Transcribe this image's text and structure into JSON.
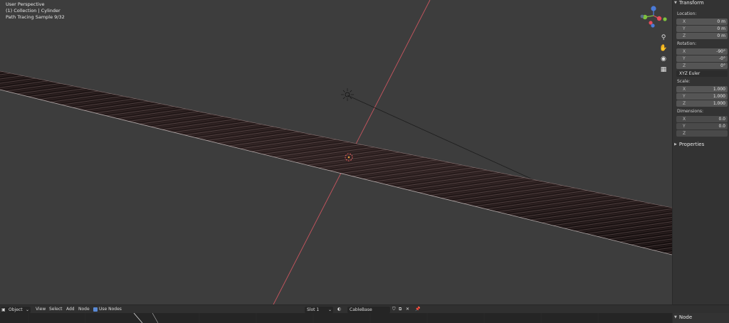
{
  "viewport": {
    "perspective": "User Perspective",
    "collection": "(1) Collection | Cylinder",
    "render_status": "Path Tracing Sample 9/32"
  },
  "gizmo": {
    "axes": [
      "X",
      "Y",
      "Z"
    ],
    "tools": [
      "zoom-icon",
      "hand-icon",
      "camera-icon",
      "grid-icon"
    ]
  },
  "npanel": {
    "transform_header": "Transform",
    "location_label": "Location:",
    "location": [
      {
        "axis": "X",
        "value": "0 m"
      },
      {
        "axis": "Y",
        "value": "0 m"
      },
      {
        "axis": "Z",
        "value": "0 m"
      }
    ],
    "rotation_label": "Rotation:",
    "rotation": [
      {
        "axis": "X",
        "value": "-90°"
      },
      {
        "axis": "Y",
        "value": "-0°"
      },
      {
        "axis": "Z",
        "value": "0°"
      }
    ],
    "rotation_mode": "XYZ Euler",
    "scale_label": "Scale:",
    "scale": [
      {
        "axis": "X",
        "value": "1.000"
      },
      {
        "axis": "Y",
        "value": "1.000"
      },
      {
        "axis": "Z",
        "value": "1.000"
      }
    ],
    "dimensions_label": "Dimensions:",
    "dimensions": [
      {
        "axis": "X",
        "value": "0.0"
      },
      {
        "axis": "Y",
        "value": "0.0"
      },
      {
        "axis": "Z",
        "value": ""
      }
    ],
    "properties_header": "Properties"
  },
  "bottombar": {
    "mode": "Object",
    "menus": [
      "View",
      "Select",
      "Add",
      "Node"
    ],
    "use_nodes_label": "Use Nodes",
    "slot": "Slot 1",
    "material_name": "CableBase"
  },
  "node_sidebar": {
    "header": "Node"
  },
  "colors": {
    "viewport_bg": "#3d3d3d",
    "x_axis_line": "#c8555f",
    "gizmo_x": "#e84b5a",
    "gizmo_y": "#7ec23e",
    "gizmo_z": "#4b7bd8",
    "accent_blue": "#5a8ad6"
  }
}
